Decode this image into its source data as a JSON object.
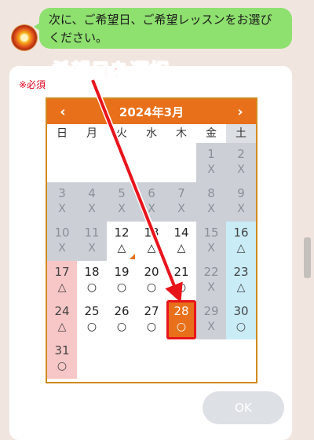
{
  "chat": {
    "message": "次に、ご希望日、ご希望レッスンをお選びください。"
  },
  "form": {
    "required_label": "※必須",
    "ok_label": "OK"
  },
  "annotation": {
    "label": "希望日を選択"
  },
  "calendar": {
    "title": "2024年3月",
    "prev_icon": "‹",
    "next_icon": "›",
    "weekdays": [
      "日",
      "月",
      "火",
      "水",
      "木",
      "金",
      "土"
    ],
    "days": [
      {
        "day": "",
        "mark": "",
        "state": "empty"
      },
      {
        "day": "",
        "mark": "",
        "state": "empty"
      },
      {
        "day": "",
        "mark": "",
        "state": "empty"
      },
      {
        "day": "",
        "mark": "",
        "state": "empty"
      },
      {
        "day": "",
        "mark": "",
        "state": "empty"
      },
      {
        "day": "1",
        "mark": "X",
        "state": "closed"
      },
      {
        "day": "2",
        "mark": "X",
        "state": "closed"
      },
      {
        "day": "3",
        "mark": "X",
        "state": "closed"
      },
      {
        "day": "4",
        "mark": "X",
        "state": "closed"
      },
      {
        "day": "5",
        "mark": "X",
        "state": "closed"
      },
      {
        "day": "6",
        "mark": "X",
        "state": "closed"
      },
      {
        "day": "7",
        "mark": "X",
        "state": "closed"
      },
      {
        "day": "8",
        "mark": "X",
        "state": "closed"
      },
      {
        "day": "9",
        "mark": "X",
        "state": "closed"
      },
      {
        "day": "10",
        "mark": "X",
        "state": "closed"
      },
      {
        "day": "11",
        "mark": "X",
        "state": "closed"
      },
      {
        "day": "12",
        "mark": "△",
        "state": "open",
        "corner": true
      },
      {
        "day": "13",
        "mark": "△",
        "state": "open"
      },
      {
        "day": "14",
        "mark": "△",
        "state": "open"
      },
      {
        "day": "15",
        "mark": "X",
        "state": "closed"
      },
      {
        "day": "16",
        "mark": "△",
        "state": "sat"
      },
      {
        "day": "17",
        "mark": "△",
        "state": "sun"
      },
      {
        "day": "18",
        "mark": "○",
        "state": "open"
      },
      {
        "day": "19",
        "mark": "○",
        "state": "open"
      },
      {
        "day": "20",
        "mark": "○",
        "state": "open"
      },
      {
        "day": "21",
        "mark": "○",
        "state": "open"
      },
      {
        "day": "22",
        "mark": "X",
        "state": "closed"
      },
      {
        "day": "23",
        "mark": "△",
        "state": "sat"
      },
      {
        "day": "24",
        "mark": "△",
        "state": "sun"
      },
      {
        "day": "25",
        "mark": "○",
        "state": "open"
      },
      {
        "day": "26",
        "mark": "○",
        "state": "open"
      },
      {
        "day": "27",
        "mark": "○",
        "state": "open"
      },
      {
        "day": "28",
        "mark": "○",
        "state": "selected"
      },
      {
        "day": "29",
        "mark": "X",
        "state": "closed"
      },
      {
        "day": "30",
        "mark": "○",
        "state": "sat"
      },
      {
        "day": "31",
        "mark": "○",
        "state": "sun"
      }
    ]
  },
  "colors": {
    "accent": "#e8701a",
    "bubble": "#8ee06f",
    "annotation": "#ff1010",
    "closed": "#ccd0d6",
    "sunday": "#f7c6c6",
    "saturday": "#c9ecf7"
  },
  "icons": {
    "avatar": "avatar-icon",
    "prev": "chevron-left-icon",
    "next": "chevron-right-icon"
  }
}
